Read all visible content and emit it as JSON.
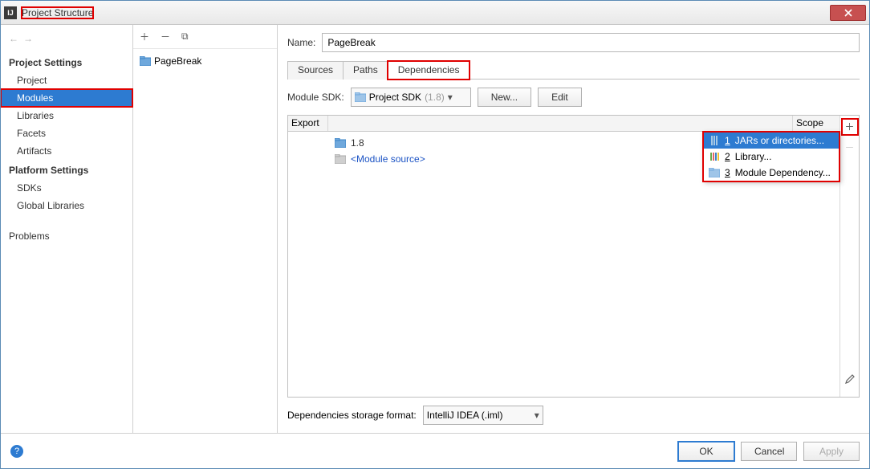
{
  "window": {
    "title": "Project Structure"
  },
  "sidebar": {
    "sections": [
      {
        "title": "Project Settings",
        "items": [
          "Project",
          "Modules",
          "Libraries",
          "Facets",
          "Artifacts"
        ],
        "selected_index": 1
      },
      {
        "title": "Platform Settings",
        "items": [
          "SDKs",
          "Global Libraries"
        ]
      }
    ],
    "extra_item": "Problems"
  },
  "module_tree": {
    "items": [
      "PageBreak"
    ]
  },
  "main": {
    "name_label": "Name:",
    "name_value": "PageBreak",
    "tabs": [
      "Sources",
      "Paths",
      "Dependencies"
    ],
    "active_tab": 2,
    "sdk_label": "Module SDK:",
    "sdk_text": "Project SDK",
    "sdk_ver": "(1.8)",
    "new_btn": "New...",
    "edit_btn": "Edit",
    "cols": {
      "export": "Export",
      "scope": "Scope"
    },
    "deps": [
      {
        "label": "1.8",
        "icon": "folder",
        "link": false
      },
      {
        "label": "<Module source>",
        "icon": "folder-gray",
        "link": true
      }
    ],
    "add_menu": [
      {
        "num": "1",
        "label": "JARs or directories...",
        "icon": "jar",
        "selected": true
      },
      {
        "num": "2",
        "label": "Library...",
        "icon": "library",
        "selected": false
      },
      {
        "num": "3",
        "label": "Module Dependency...",
        "icon": "module",
        "selected": false
      }
    ],
    "storage_label": "Dependencies storage format:",
    "storage_value": "IntelliJ IDEA (.iml)"
  },
  "footer": {
    "ok": "OK",
    "cancel": "Cancel",
    "apply": "Apply"
  }
}
